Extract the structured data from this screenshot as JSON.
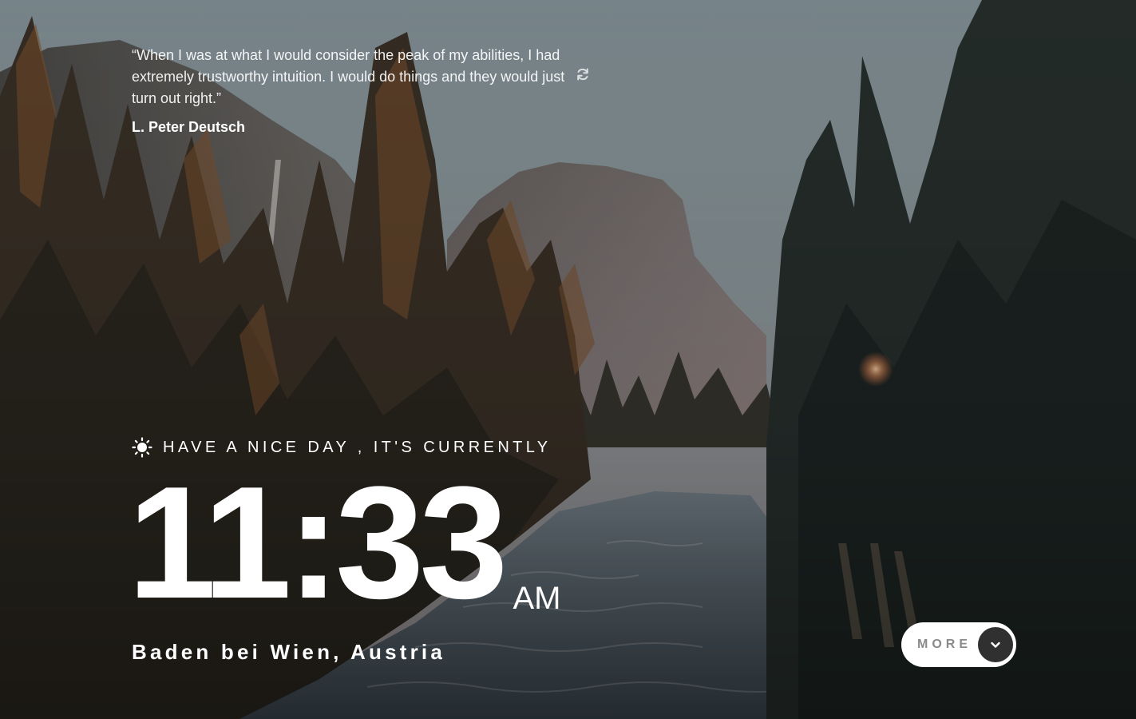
{
  "quote": {
    "text": "“When I was at what I would consider the peak of my abilities, I had extremely trustworthy intuition. I would do things and they would just turn out right.”",
    "author": "L. Peter Deutsch",
    "refresh_icon": "refresh-icon"
  },
  "greeting": {
    "icon": "sun-icon",
    "text": "HAVE A NICE DAY , IT'S CURRENTLY"
  },
  "clock": {
    "time": "11:33",
    "period": "AM"
  },
  "location": {
    "text": "Baden bei Wien, Austria"
  },
  "more_button": {
    "label": "MORE",
    "icon": "chevron-down-icon"
  },
  "colors": {
    "text": "#ffffff",
    "button_bg": "#ffffff",
    "button_label": "#8a8a8a",
    "chevron_bg": "#303030"
  }
}
